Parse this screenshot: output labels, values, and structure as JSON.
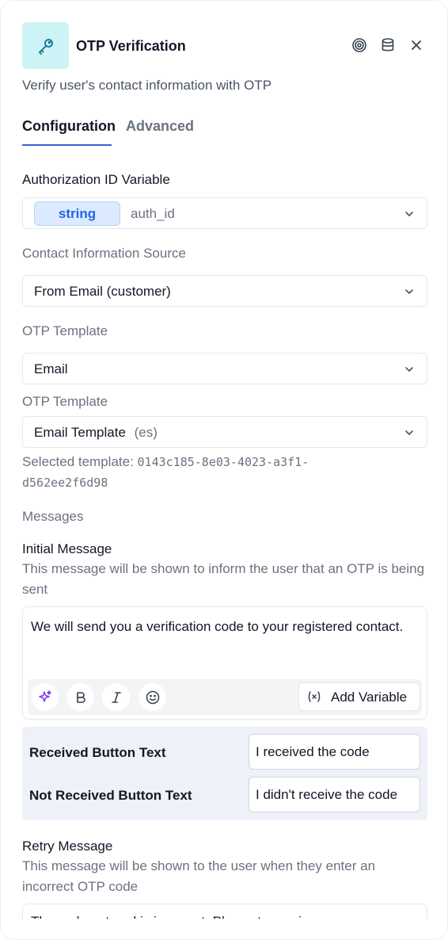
{
  "header": {
    "title": "OTP Verification",
    "subtitle": "Verify user's contact information with OTP",
    "icons": {
      "node": "key-icon",
      "target": "target-icon",
      "database": "database-icon",
      "close": "close-icon"
    },
    "node_icon_bg": "#cdf3f6",
    "node_icon_color": "#0e7490"
  },
  "tabs": [
    {
      "label": "Configuration",
      "active": true
    },
    {
      "label": "Advanced",
      "active": false
    }
  ],
  "auth_var": {
    "label": "Authorization ID Variable",
    "type": "string",
    "value": "auth_id"
  },
  "contact_source": {
    "label": "Contact Information Source",
    "value": "From Email (customer)"
  },
  "otp_channel": {
    "label": "OTP Template",
    "value": "Email"
  },
  "otp_template": {
    "label": "OTP Template",
    "value": "Email Template",
    "lang": "(es)",
    "selected_prefix": "Selected template: ",
    "selected_id_line1": "0143c185-8e03-4023-a3f1-",
    "selected_id_line2": "d562ee2f6d98"
  },
  "messages": {
    "section_label": "Messages",
    "initial": {
      "label": "Initial Message",
      "help": "This message will be shown to inform the user that an OTP is being sent",
      "text": "We will send you a verification code to your registered contact.",
      "add_variable": "Add Variable"
    },
    "buttons": {
      "received_label": "Received Button Text",
      "received_value": "I received the code",
      "not_received_label": "Not Received Button Text",
      "not_received_value": "I didn't receive the code"
    },
    "retry": {
      "label": "Retry Message",
      "help": "This message will be shown to the user when they enter an incorrect OTP code",
      "text": "The code entered is incorrect. Please try again."
    }
  },
  "colors": {
    "accent": "#3b5fdb",
    "pill_bg": "#dbeafe",
    "pill_text": "#2563eb",
    "sparkle": "#7c3aed"
  }
}
